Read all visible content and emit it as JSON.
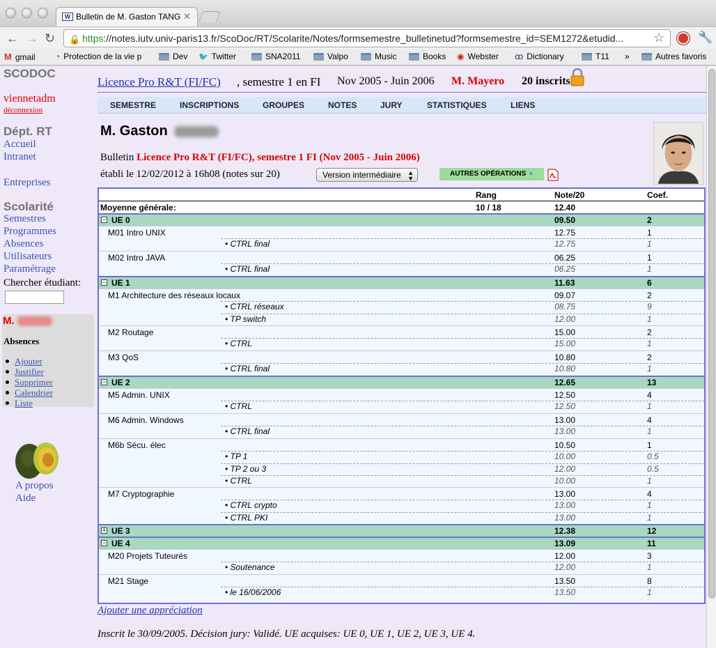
{
  "browser": {
    "tab_title": "Bulletin de M. Gaston TANG",
    "favicon_text": "W",
    "url_scheme": "https",
    "url_rest": "://notes.iutv.univ-paris13.fr/ScoDoc/RT/Scolarite/Notes/formsemestre_bulletinetud?formsemestre_id=SEM1272&etudid...",
    "bookmarks": [
      {
        "label": "gmail",
        "icon": "gmail-icon"
      },
      {
        "label": "Protection de la vie p",
        "icon": "globe-icon"
      },
      {
        "label": "Dev",
        "icon": "folder-icon"
      },
      {
        "label": "Twitter",
        "icon": "twitter-icon"
      },
      {
        "label": "SNA2011",
        "icon": "folder-icon"
      },
      {
        "label": "Valpo",
        "icon": "folder-icon"
      },
      {
        "label": "Music",
        "icon": "folder-icon"
      },
      {
        "label": "Books",
        "icon": "folder-icon"
      },
      {
        "label": "Webster",
        "icon": "webster-icon"
      },
      {
        "label": "Dictionary",
        "icon": "dictionary-icon"
      },
      {
        "label": "T11",
        "icon": "folder-icon"
      },
      {
        "label": "»",
        "icon": ""
      },
      {
        "label": "Autres favoris",
        "icon": "folder-icon"
      }
    ]
  },
  "sidebar": {
    "app_name": "SCODOC",
    "user": "viennetadm",
    "logout": "déconnexion",
    "dept": "Dépt. RT",
    "dept_links": [
      "Accueil",
      "Intranet"
    ],
    "entreprises": "Entreprises",
    "scolarite": "Scolarité",
    "scol_links": [
      "Semestres",
      "Programmes",
      "Absences",
      "Utilisateurs",
      "Paramétrage"
    ],
    "search_label": "Chercher étudiant:",
    "student_prefix": "M.",
    "absences_title": "Absences",
    "absence_links": [
      "Ajouter",
      "Justifier",
      "Supprimer",
      "Calendrier",
      "Liste"
    ],
    "about": "A propos",
    "help": "Aide"
  },
  "header": {
    "formation": "Licence Pro R&T (FI/FC)",
    "semestre": ", semestre 1 en FI",
    "dates": "Nov 2005 - Juin 2006",
    "responsable": "M. Mayero",
    "inscrits": "20 inscrits"
  },
  "menu": [
    "SEMESTRE",
    "INSCRIPTIONS",
    "GROUPES",
    "NOTES",
    "JURY",
    "STATISTIQUES",
    "LIENS"
  ],
  "student": {
    "name": "M. Gaston",
    "bulletin_word": "Bulletin",
    "bulletin_title": "Licence Pro R&T (FI/FC), semestre 1 FI (Nov 2005 - Juin 2006)",
    "established": "établi le 12/02/2012 à 16h08 (notes sur 20)",
    "version": "Version intermédiaire",
    "other_ops": "AUTRES OPÉRATIONS"
  },
  "table": {
    "headers": {
      "rang": "Rang",
      "note": "Note/20",
      "coef": "Coef."
    },
    "moyenne": {
      "label": "Moyenne générale:",
      "rang": "10 / 18",
      "note": "12.40"
    }
  },
  "rows": [
    {
      "kind": "ue",
      "toggle": "−",
      "label": "UE 0",
      "note": "09.50",
      "coef": "2"
    },
    {
      "kind": "mod",
      "label": "M01 Intro UNIX",
      "note": "12.75",
      "coef": "1"
    },
    {
      "kind": "eval",
      "label": "• CTRL final",
      "note": "12.75",
      "coef": "1"
    },
    {
      "kind": "mod",
      "label": "M02 Intro JAVA",
      "note": "06.25",
      "coef": "1"
    },
    {
      "kind": "eval",
      "label": "• CTRL final",
      "note": "06.25",
      "coef": "1"
    },
    {
      "kind": "ue",
      "toggle": "−",
      "label": "UE 1",
      "note": "11.63",
      "coef": "6"
    },
    {
      "kind": "mod",
      "label": "M1 Architecture des réseaux locaux",
      "note": "09.07",
      "coef": "2"
    },
    {
      "kind": "eval",
      "label": "• CTRL réseaux",
      "note": "08.75",
      "coef": "9"
    },
    {
      "kind": "eval2",
      "label": "• TP switch",
      "note": "12.00",
      "coef": "1"
    },
    {
      "kind": "mod",
      "label": "M2 Routage",
      "note": "15.00",
      "coef": "2"
    },
    {
      "kind": "eval",
      "label": "• CTRL",
      "note": "15.00",
      "coef": "1"
    },
    {
      "kind": "mod",
      "label": "M3 QoS",
      "note": "10.80",
      "coef": "2"
    },
    {
      "kind": "eval",
      "label": "• CTRL final",
      "note": "10.80",
      "coef": "1"
    },
    {
      "kind": "ue",
      "toggle": "−",
      "label": "UE 2",
      "note": "12.65",
      "coef": "13"
    },
    {
      "kind": "mod",
      "label": "M5 Admin. UNIX",
      "note": "12.50",
      "coef": "4"
    },
    {
      "kind": "eval",
      "label": "• CTRL",
      "note": "12.50",
      "coef": "1"
    },
    {
      "kind": "mod",
      "label": "M6 Admin. Windows",
      "note": "13.00",
      "coef": "4"
    },
    {
      "kind": "eval",
      "label": "• CTRL final",
      "note": "13.00",
      "coef": "1"
    },
    {
      "kind": "mod",
      "label": "M6b Sécu. élec",
      "note": "10.50",
      "coef": "1"
    },
    {
      "kind": "eval",
      "label": "• TP 1",
      "note": "10.00",
      "coef": "0.5"
    },
    {
      "kind": "eval2",
      "label": "• TP 2 ou 3",
      "note": "12.00",
      "coef": "0.5"
    },
    {
      "kind": "eval2",
      "label": "• CTRL",
      "note": "10.00",
      "coef": "1"
    },
    {
      "kind": "mod",
      "label": "M7 Cryptographie",
      "note": "13.00",
      "coef": "4"
    },
    {
      "kind": "eval",
      "label": "• CTRL crypto",
      "note": "13.00",
      "coef": "1"
    },
    {
      "kind": "eval2",
      "label": "• CTRL PKI",
      "note": "13.00",
      "coef": "1"
    },
    {
      "kind": "ue",
      "toggle": "+",
      "label": "UE 3",
      "note": "12.38",
      "coef": "12"
    },
    {
      "kind": "ue",
      "toggle": "−",
      "label": "UE 4",
      "note": "13.09",
      "coef": "11"
    },
    {
      "kind": "mod",
      "label": "M20 Projets Tuteurés",
      "note": "12.00",
      "coef": "3"
    },
    {
      "kind": "eval",
      "label": "• Soutenance",
      "note": "12.00",
      "coef": "1"
    },
    {
      "kind": "mod",
      "label": "M21 Stage",
      "note": "13.50",
      "coef": "8"
    },
    {
      "kind": "eval",
      "label": "• le 16/06/2006",
      "note": "13.50",
      "coef": "1"
    }
  ],
  "appreciation_link": "Ajouter une appréciation",
  "footer": "Inscrit le 30/09/2005. Décision jury: Validé. UE acquises: UE 0, UE 1, UE 2, UE 3, UE 4."
}
